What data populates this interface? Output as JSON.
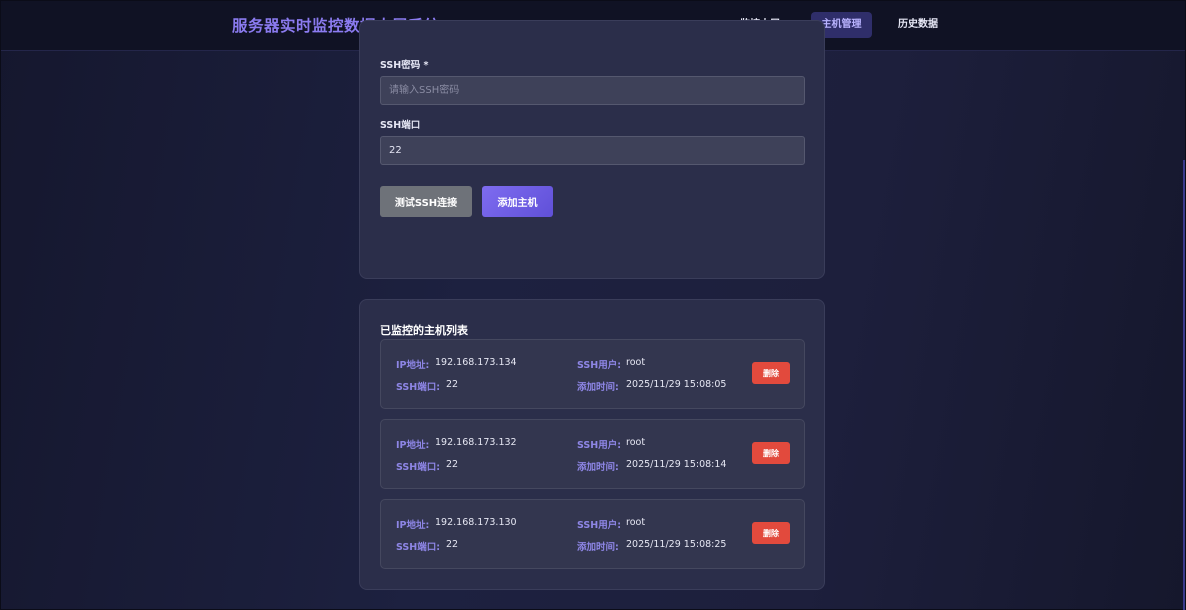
{
  "header": {
    "title": "服务器实时监控数据大屏系统",
    "nav": [
      {
        "label": "监控大屏",
        "active": false
      },
      {
        "label": "主机管理",
        "active": true
      },
      {
        "label": "历史数据",
        "active": false
      }
    ]
  },
  "form": {
    "ssh_password": {
      "label": "SSH密码 *",
      "value": "",
      "placeholder": "请输入SSH密码"
    },
    "ssh_port": {
      "label": "SSH端口",
      "value": "22"
    },
    "test_button": "测试SSH连接",
    "add_button": "添加主机"
  },
  "hosts": {
    "title": "已监控的主机列表",
    "labels": {
      "ip": "IP地址:",
      "user": "SSH用户:",
      "port": "SSH端口:",
      "time": "添加时间:",
      "delete": "删除"
    },
    "items": [
      {
        "ip": "192.168.173.134",
        "user": "root",
        "port": "22",
        "time": "2025/11/29 15:08:05"
      },
      {
        "ip": "192.168.173.132",
        "user": "root",
        "port": "22",
        "time": "2025/11/29 15:08:14"
      },
      {
        "ip": "192.168.173.130",
        "user": "root",
        "port": "22",
        "time": "2025/11/29 15:08:25"
      }
    ]
  },
  "colors": {
    "accent": "#7e6cf0",
    "danger": "#e24a3d",
    "label": "#8e86e6",
    "background": "#1d2140",
    "card": "#2b2e4a"
  }
}
